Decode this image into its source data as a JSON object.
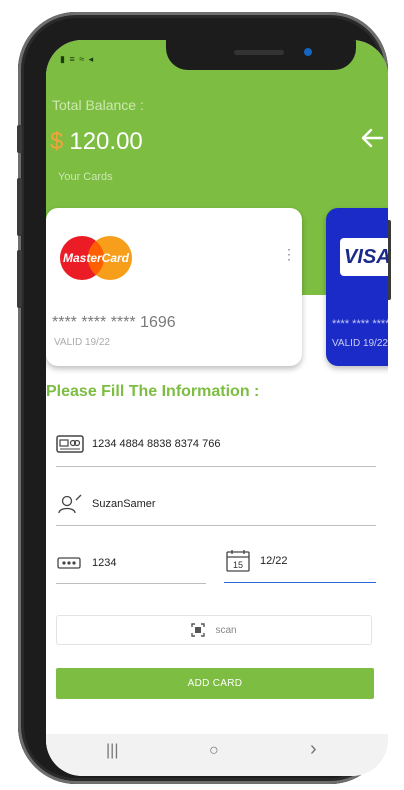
{
  "status_bar": {
    "text": "▮ ≡ ≈ ◂"
  },
  "header": {
    "balance_label": "Total Balance :",
    "currency_symbol": "$",
    "balance_value": "120.00",
    "cards_label": "Your Cards",
    "back_icon": "arrow-left-icon"
  },
  "cards": [
    {
      "brand": "MasterCard",
      "number": "**** **** **** 1696",
      "valid": "VALID 19/22"
    },
    {
      "brand": "VISA",
      "number": "**** **** ****",
      "valid": "VALID 19/22"
    }
  ],
  "form": {
    "title": "Please Fill The Information :",
    "card_number": "1234 4884 8838 8374 766",
    "name": "SuzanSamer",
    "cvv": "1234",
    "expiry": "12/22",
    "calendar_day": "15",
    "scan_label": "scan",
    "add_card_label": "ADD CARD"
  },
  "nav": {
    "recents": "|||",
    "home": "○",
    "back": "›"
  },
  "colors": {
    "accent": "#7cbd42",
    "visa_blue": "#1a2bc7",
    "currency": "#f2a33a",
    "focus_line": "#2a6ad8"
  }
}
